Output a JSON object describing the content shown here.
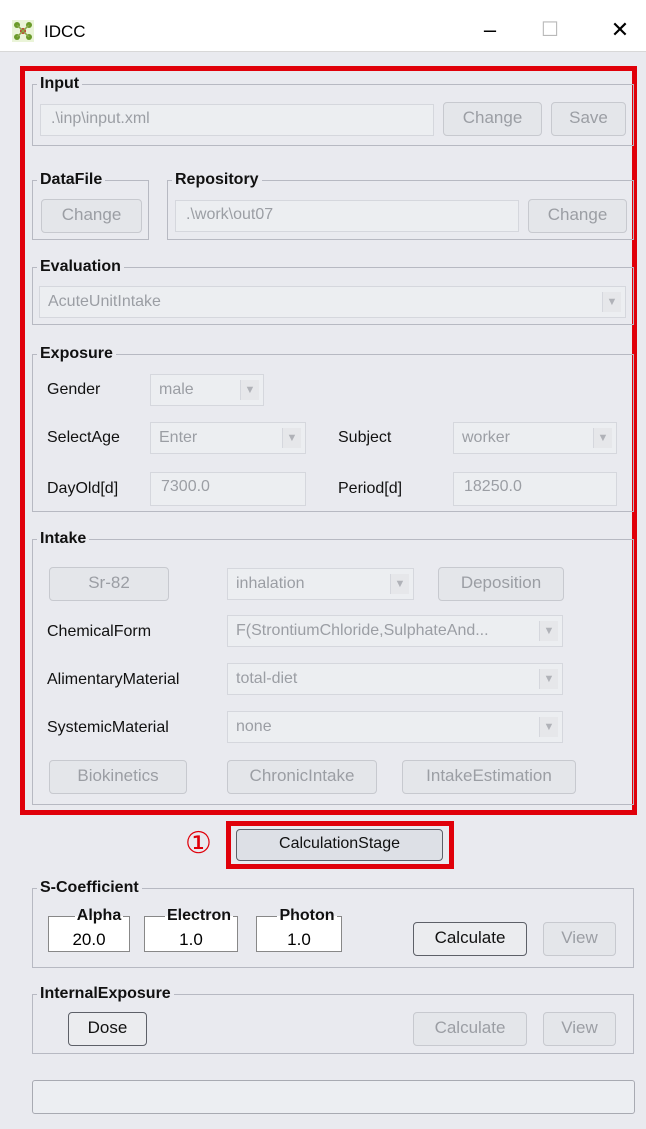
{
  "window": {
    "title": "IDCC",
    "minimize": "–",
    "maximize": "☐",
    "close": "✕"
  },
  "input": {
    "legend": "Input",
    "path": ".\\inp\\input.xml",
    "change": "Change",
    "save": "Save"
  },
  "datafile": {
    "legend": "DataFile",
    "change": "Change"
  },
  "repository": {
    "legend": "Repository",
    "path": ".\\work\\out07",
    "change": "Change"
  },
  "evaluation": {
    "legend": "Evaluation",
    "value": "AcuteUnitIntake"
  },
  "exposure": {
    "legend": "Exposure",
    "gender_label": "Gender",
    "gender_value": "male",
    "selectage_label": "SelectAge",
    "selectage_value": "Enter",
    "subject_label": "Subject",
    "subject_value": "worker",
    "dayold_label": "DayOld[d]",
    "dayold_value": "7300.0",
    "period_label": "Period[d]",
    "period_value": "18250.0"
  },
  "intake": {
    "legend": "Intake",
    "nuclide": "Sr-82",
    "route": "inhalation",
    "deposition": "Deposition",
    "chemical_label": "ChemicalForm",
    "chemical_value": "F(StrontiumChloride,SulphateAnd...",
    "alimentary_label": "AlimentaryMaterial",
    "alimentary_value": "total-diet",
    "systemic_label": "SystemicMaterial",
    "systemic_value": "none",
    "biokinetics": "Biokinetics",
    "chronic": "ChronicIntake",
    "estimation": "IntakeEstimation"
  },
  "calc_stage": {
    "marker": "①",
    "label": "CalculationStage"
  },
  "scoef": {
    "legend": "S-Coefficient",
    "alpha_label": "Alpha",
    "alpha_value": "20.0",
    "electron_label": "Electron",
    "electron_value": "1.0",
    "photon_label": "Photon",
    "photon_value": "1.0",
    "calculate": "Calculate",
    "view": "View"
  },
  "internal": {
    "legend": "InternalExposure",
    "dose": "Dose",
    "calculate": "Calculate",
    "view": "View"
  },
  "colors": {
    "highlight": "#e0000a",
    "panel": "#e9eaef"
  }
}
